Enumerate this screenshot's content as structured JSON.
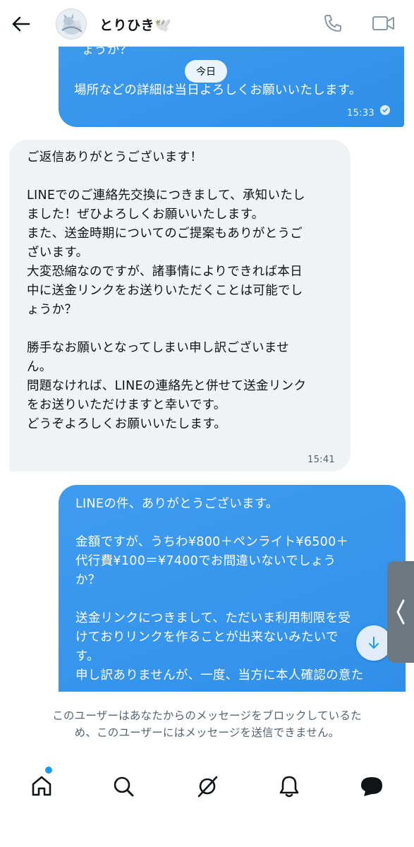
{
  "header": {
    "back_icon": "arrow-left-icon",
    "name": "とりひき🕊️",
    "call_icon": "phone-icon",
    "video_icon": "video-icon"
  },
  "messages": {
    "top_bubble": {
      "partial_line": "ょうか？",
      "date_pill": "今日",
      "text": "場所などの詳細は当日よろしくお願いいたします。",
      "time": "15:33"
    },
    "incoming": {
      "text": "ご返信ありがとうございます！\n\nLINEでのご連絡先交換につきまして、承知いたし\nました！ぜひよろしくお願いいたします。\nまた、送金時期についてのご提案もありがとうご\nざいます。\n大変恐縮なのですが、諸事情によりできれば本日\n中に送金リンクをお送りいただくことは可能でし\nょうか？\n\n勝手なお願いとなってしまい申し訳ございませ\nん。\n問題なければ、LINEの連絡先と併せて送金リンク\nをお送りいただけますと幸いです。\nどうぞよろしくお願いいたします。",
      "time": "15:41"
    },
    "outgoing": {
      "text": "LINEの件、ありがとうございます。\n\n金額ですが、うちわ¥800＋ペンライト¥6500＋\n代行費¥100＝¥7400でお間違いないでしょう\nか？\n\n送金リンクにつきまして、ただいま利用制限を受\nけておりリンクを作ることが出来ないみたいで\nす。\n申し訳ありませんが、一度、当方に本人確認の意た"
    }
  },
  "notice": {
    "text": "このユーザーはあなたからのメッセージをブロックしているた\nめ、このユーザーにはメッセージを送信できません。"
  },
  "nav": {
    "home": "home-icon",
    "search": "search-icon",
    "grok": "grok-icon",
    "notifications": "bell-icon",
    "messages": "messages-icon"
  },
  "colors": {
    "accent": "#1d9bf0",
    "bubble_out": "#3196ec",
    "bubble_in": "#eff3f4",
    "muted_text": "#536471"
  }
}
